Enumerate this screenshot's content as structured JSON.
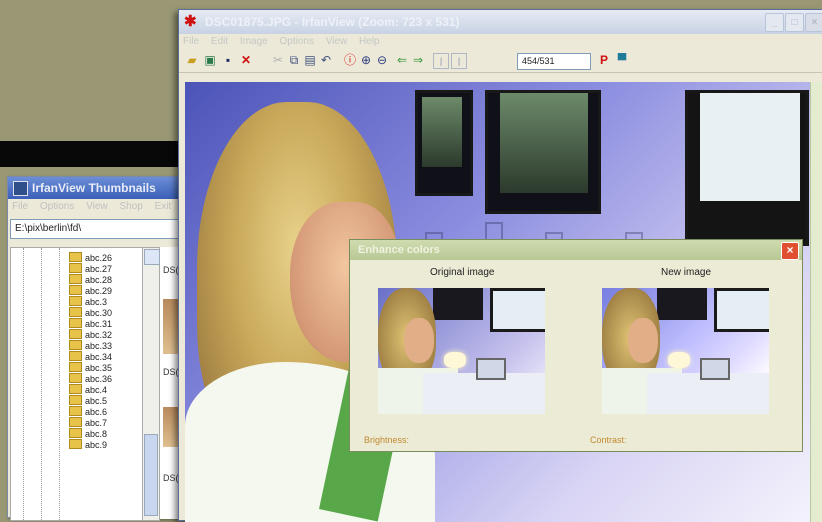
{
  "thumbnails_window": {
    "title": "IrfanView Thumbnails",
    "menu": [
      "File",
      "Options",
      "View",
      "Shop",
      "Exit"
    ],
    "path": "E:\\pix\\berlin\\fd\\",
    "tree_items": [
      "abc.26",
      "abc.27",
      "abc.28",
      "abc.29",
      "abc.3",
      "abc.30",
      "abc.31",
      "abc.32",
      "abc.33",
      "abc.34",
      "abc.35",
      "abc.36",
      "abc.4",
      "abc.5",
      "abc.6",
      "abc.7",
      "abc.8",
      "abc.9"
    ],
    "thumb_labels": [
      "DS(",
      "DS(",
      "DS("
    ]
  },
  "viewer": {
    "title": "DSC01875.JPG - IrfanView (Zoom: 723 x 531)",
    "menu": [
      "File",
      "Edit",
      "Image",
      "Options",
      "View",
      "Help"
    ],
    "page_indicator": "454/531",
    "minimize_label": "_",
    "maximize_label": "□",
    "close_label": "×"
  },
  "enhance_dialog": {
    "title": "Enhance colors",
    "close_label": "×",
    "original_label": "Original image",
    "new_label": "New image",
    "brightness_label": "Brightness:",
    "contrast_label": "Contrast:"
  },
  "colors": {
    "desktop": "#9a9874",
    "dialog_close": "#e05030",
    "accent_red": "#d01010"
  }
}
